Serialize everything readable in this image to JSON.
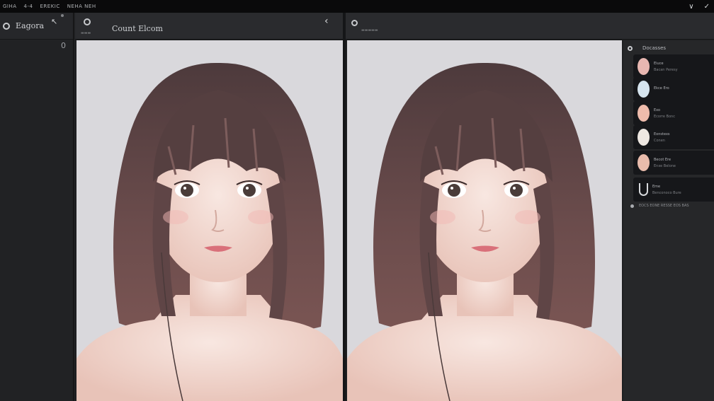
{
  "menubar": {
    "items": [
      "GIHA",
      "4-4",
      "EREKIC",
      "NEHA NEH"
    ],
    "right_icons": [
      "chevron-down-icon",
      "check-icon"
    ]
  },
  "sidebar": {
    "title": "Eagora",
    "count": "0",
    "icons": [
      "ring-icon",
      "pin-icon"
    ]
  },
  "left_panel": {
    "title": "Count Elcom",
    "icons": [
      "ring-icon",
      "chevron-left-icon"
    ]
  },
  "right_panel": {
    "icons": [
      "ring-icon"
    ]
  },
  "layers": {
    "title": "Docasses",
    "items": [
      {
        "name": "Eiuce",
        "meta": "Bacan Peresy",
        "color": "#e8b7b1"
      },
      {
        "name": "Ekce Ero",
        "meta": "",
        "color": "#d6e4ee"
      },
      {
        "name": "Exo",
        "meta": "Ecorre Bonc",
        "color": "#efbcac"
      },
      {
        "name": "Eonstexs",
        "meta": "Conen",
        "color": "#eee8e2"
      },
      {
        "name": "Becot Ere",
        "meta": "Enxe Belone",
        "color": "#e9bcac"
      },
      {
        "name": "Eme",
        "meta": "Benconoco Bure",
        "color": "none"
      }
    ],
    "footer": "EOCS EONE RESSE EOS BAS"
  },
  "colors": {
    "background": "#1e1f21",
    "canvas": "#d9d8dc",
    "hair": "#5a4445",
    "skin": "#f3dcd4"
  }
}
